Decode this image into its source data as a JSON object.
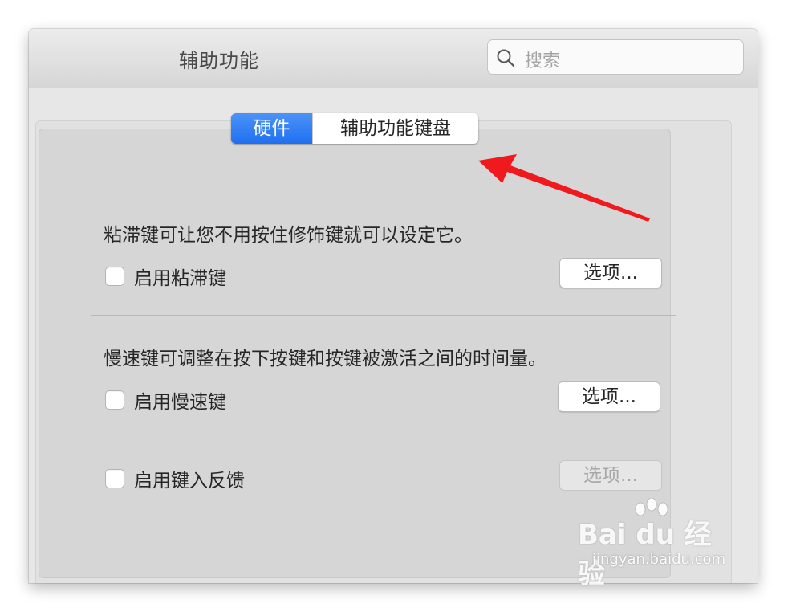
{
  "window": {
    "title": "辅助功能"
  },
  "search": {
    "placeholder": "搜索",
    "icon": "search-icon"
  },
  "tabs": [
    {
      "label": "硬件",
      "selected": true
    },
    {
      "label": "辅助功能键盘",
      "selected": false
    }
  ],
  "sections": {
    "sticky": {
      "description": "粘滞键可让您不用按住修饰键就可以设定它。",
      "checkbox_label": "启用粘滞键",
      "checked": false,
      "options_label": "选项...",
      "options_enabled": true
    },
    "slow": {
      "description": "慢速键可调整在按下按键和按键被激活之间的时间量。",
      "checkbox_label": "启用慢速键",
      "checked": false,
      "options_label": "选项...",
      "options_enabled": true
    },
    "feedback": {
      "checkbox_label": "启用键入反馈",
      "checked": false,
      "options_label": "选项...",
      "options_enabled": false
    }
  },
  "watermark": {
    "logo": "Bai du 经验",
    "url": "jingyan.baidu.com"
  },
  "colors": {
    "accent": "#2a78f4",
    "arrow": "#f0191e"
  }
}
